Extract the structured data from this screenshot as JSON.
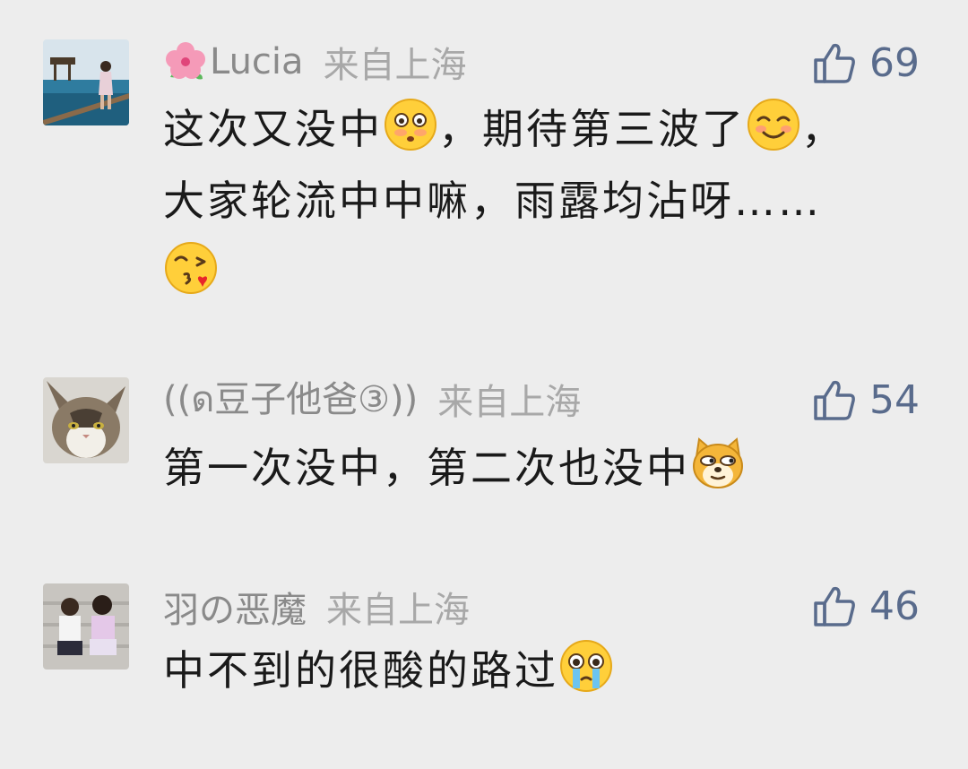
{
  "comments": [
    {
      "username": "Lucia",
      "location": "来自上海",
      "likes": "69",
      "text_parts": [
        "这次又没中",
        "，期待第三波了",
        "，",
        "大家轮流中中嘛，雨露均沾呀……"
      ],
      "emoji": [
        "flushed-face-icon",
        "smiling-face-icon",
        "kissing-wink-face-icon"
      ]
    },
    {
      "username": "((ด豆子他爸③))",
      "location": "来自上海",
      "likes": "54",
      "text_parts": [
        "第一次没中，第二次也没中"
      ],
      "emoji": [
        "doge-icon"
      ]
    },
    {
      "username": "羽の恶魔",
      "location": "来自上海",
      "likes": "46",
      "text_parts": [
        "中不到的很酸的路过"
      ],
      "emoji": [
        "crying-face-icon"
      ]
    }
  ],
  "colors": {
    "background": "#ededed",
    "username": "#8a8a8a",
    "location": "#a8a8a8",
    "like": "#596b8c",
    "text": "#1a1a1a"
  }
}
